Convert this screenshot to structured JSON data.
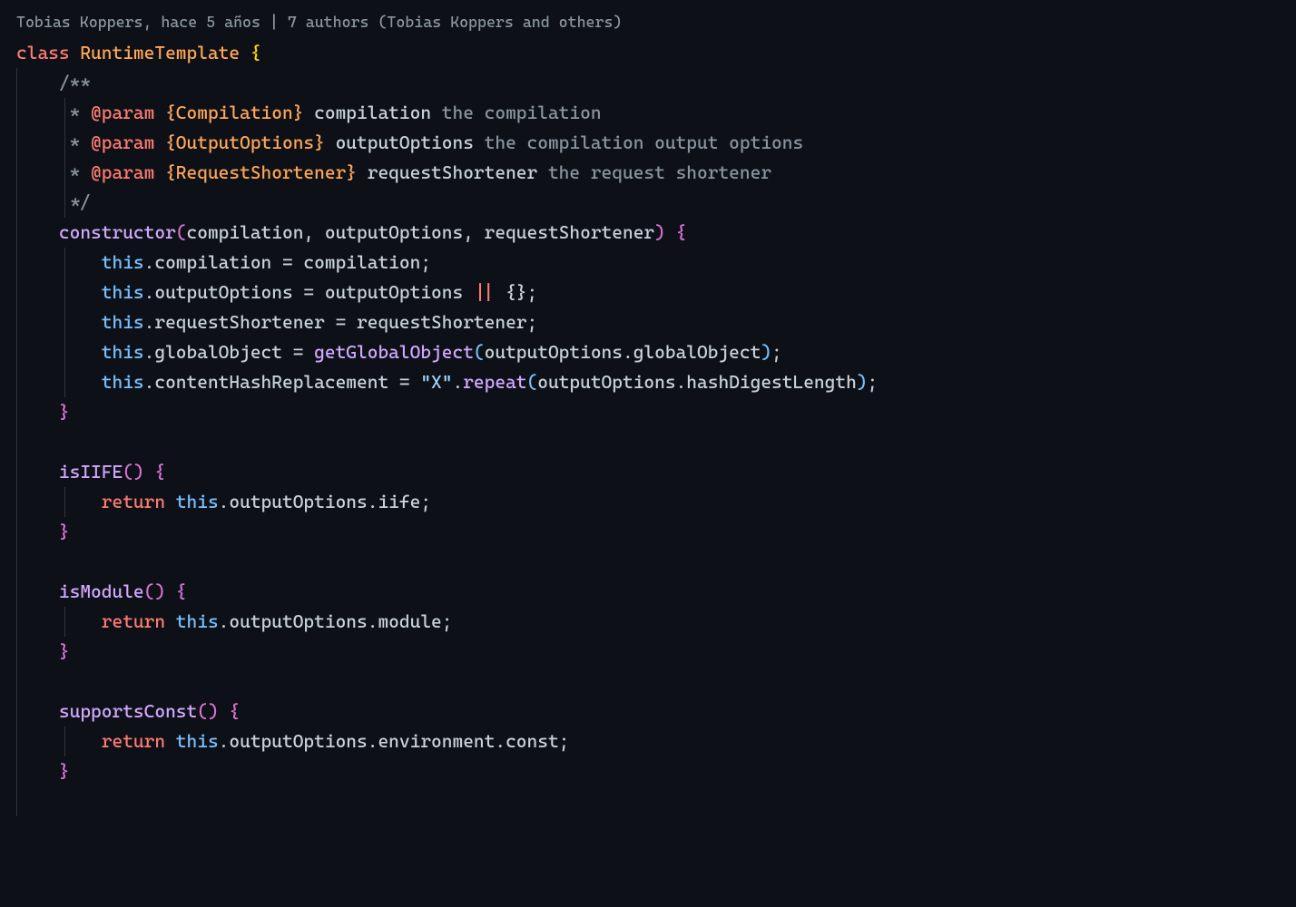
{
  "annotation": "Tobias Koppers, hace 5 años | 7 authors (Tobias Koppers and others)",
  "code": {
    "class_kw": "class",
    "class_name": "RuntimeTemplate",
    "open_brace": " {",
    "jsdoc_open": "/**",
    "jsdoc_star": " *",
    "jsdoc_param": "@param",
    "jsdoc_type1": "{Compilation}",
    "jsdoc_name1": "compilation",
    "jsdoc_desc1": "the compilation",
    "jsdoc_type2": "{OutputOptions}",
    "jsdoc_name2": "outputOptions",
    "jsdoc_desc2": "the compilation output options",
    "jsdoc_type3": "{RequestShortener}",
    "jsdoc_name3": "requestShortener",
    "jsdoc_desc3": "the request shortener",
    "jsdoc_close": " */",
    "constructor": "constructor",
    "ctor_p1": "compilation",
    "ctor_p2": "outputOptions",
    "ctor_p3": "requestShortener",
    "this": "this",
    "dot": ".",
    "prop_compilation": "compilation",
    "eq": " = ",
    "var_compilation": "compilation",
    "semi": ";",
    "prop_outputOptions": "outputOptions",
    "var_outputOptions": "outputOptions",
    "or": " || ",
    "empty_obj": "{}",
    "prop_requestShortener": "requestShortener",
    "var_requestShortener": "requestShortener",
    "prop_globalObject": "globalObject",
    "fn_getGlobalObject": "getGlobalObject",
    "prop_contentHashReplacement": "contentHashReplacement",
    "str_x": "\"X\"",
    "fn_repeat": "repeat",
    "prop_hashDigestLength": "hashDigestLength",
    "close_brace": "}",
    "method_isIIFE": "isIIFE",
    "empty_parens": "()",
    "return": "return",
    "prop_iife": "iife",
    "method_isModule": "isModule",
    "prop_module": "module",
    "method_supportsConst": "supportsConst",
    "prop_environment": "environment",
    "prop_const": "const"
  }
}
